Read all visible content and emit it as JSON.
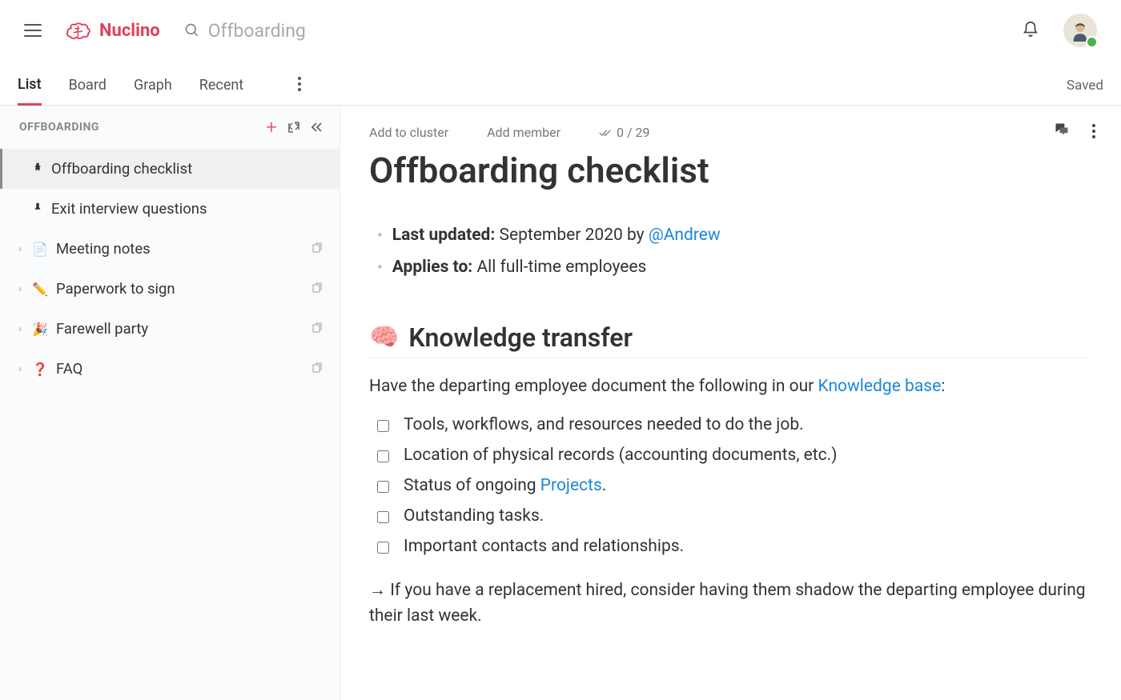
{
  "app": {
    "name": "Nuclino"
  },
  "search": {
    "placeholder": "Offboarding"
  },
  "view_tabs": {
    "items": [
      {
        "label": "List",
        "active": true
      },
      {
        "label": "Board",
        "active": false
      },
      {
        "label": "Graph",
        "active": false
      },
      {
        "label": "Recent",
        "active": false
      }
    ]
  },
  "save_status": "Saved",
  "sidebar": {
    "title": "OFFBOARDING",
    "items": [
      {
        "label": "Offboarding checklist",
        "pinned": true,
        "active": true,
        "expandable": false
      },
      {
        "label": "Exit interview questions",
        "pinned": true,
        "active": false,
        "expandable": false
      },
      {
        "label": "Meeting notes",
        "emoji": "📄",
        "expandable": true
      },
      {
        "label": "Paperwork to sign",
        "emoji": "✏️",
        "expandable": true
      },
      {
        "label": "Farewell party",
        "emoji": "🎉",
        "expandable": true
      },
      {
        "label": "FAQ",
        "emoji": "❓",
        "expandable": true
      }
    ]
  },
  "doc": {
    "meta": {
      "add_cluster": "Add to cluster",
      "add_member": "Add member",
      "tasks": "0 / 29"
    },
    "title": "Offboarding checklist",
    "info": {
      "updated_label": "Last updated:",
      "updated_value": "September 2020 by ",
      "updated_mention": "@Andrew",
      "applies_label": "Applies to:",
      "applies_value": "All full-time employees"
    },
    "section1": {
      "emoji": "🧠",
      "title": "Knowledge transfer",
      "intro_before": "Have the departing employee document  the following in our ",
      "intro_link": "Knowledge base",
      "intro_after": ":"
    },
    "checklist": [
      "Tools, workflows, and resources needed to do the job.",
      "Location of physical records (accounting documents, etc.)",
      "Status of ongoing ",
      "Outstanding tasks.",
      "Important contacts and relationships."
    ],
    "checklist_item3_link": "Projects",
    "checklist_item3_after": ".",
    "note": "→ If you have a replacement hired, consider having them shadow the departing employee during their last week."
  }
}
